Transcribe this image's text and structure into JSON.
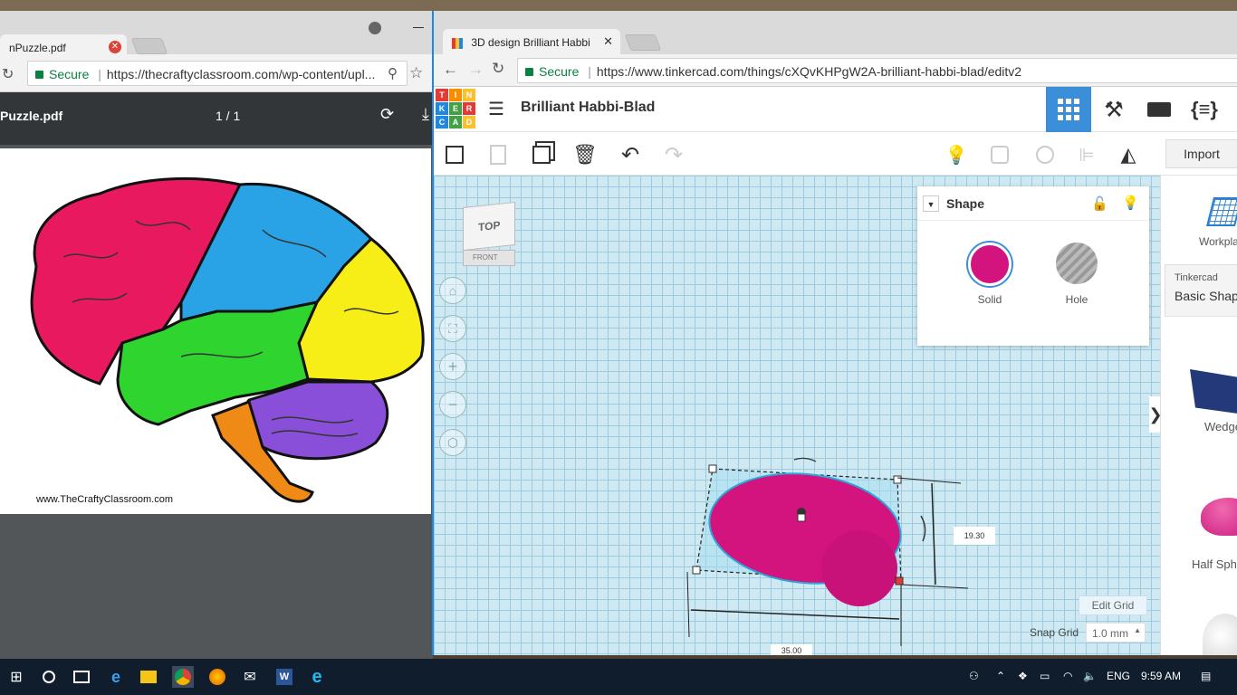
{
  "left_window": {
    "tab_title": "nPuzzle.pdf",
    "secure_label": "Secure",
    "url": "https://thecraftyclassroom.com/wp-content/upl...",
    "pdf_filename": "Puzzle.pdf",
    "page_indicator": "1 / 1",
    "page_footer": "www.TheCraftyClassroom.com"
  },
  "right_window": {
    "tab_title": "3D design Brilliant Habbi",
    "secure_label": "Secure",
    "url": "https://www.tinkercad.com/things/cXQvKHPgW2A-brilliant-habbi-blad/editv2",
    "logo_letters": [
      "T",
      "I",
      "N",
      "K",
      "E",
      "R",
      "C",
      "A",
      "D"
    ],
    "design_title": "Brilliant Habbi-Blad",
    "import_label": "Import",
    "viewcube": {
      "top": "TOP",
      "front": "FRONT"
    },
    "shape_panel": {
      "title": "Shape",
      "solid_label": "Solid",
      "hole_label": "Hole",
      "solid_color": "#d4147e"
    },
    "dimensions": {
      "height": "19.30",
      "width": "35.00"
    },
    "edit_grid_label": "Edit Grid",
    "snap_grid_label": "Snap Grid",
    "snap_grid_value": "1.0 mm",
    "sidebar": {
      "workplane_label": "Workpla",
      "library_small": "Tinkercad",
      "library_name": "Basic Shap",
      "shapes": [
        "Wedge",
        "Half Sph"
      ]
    }
  },
  "taskbar": {
    "language": "ENG",
    "time": "9:59 AM"
  },
  "colors": {
    "accent_blue": "#1e88e5",
    "tinkercad_blue": "#3b8fd8",
    "shape_magenta": "#d4147e"
  }
}
